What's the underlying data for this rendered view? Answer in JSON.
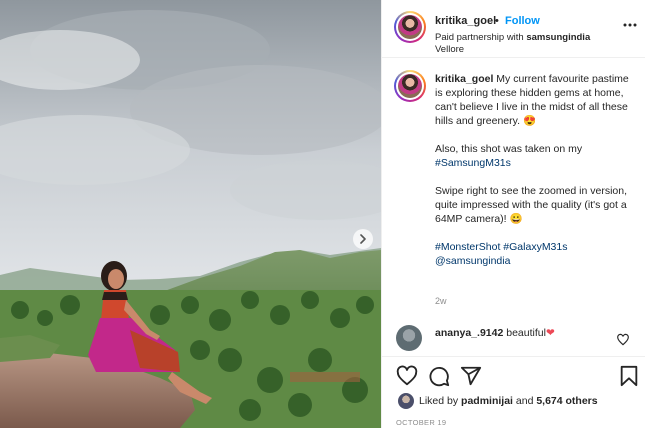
{
  "post": {
    "username": "kritika_goel",
    "follow_label": "Follow",
    "dot": "•",
    "paid_prefix": "Paid partnership with ",
    "partner": "samsungindia",
    "location": "Vellore"
  },
  "caption": {
    "username": "kritika_goel",
    "para1": " My current favourite pastime is exploring these hidden gems at home, can't believe I live in the midst of all these hills and greenery. 😍",
    "para2_text": "Also, this shot was taken on my ",
    "para2_tag": "#SamsungM31s",
    "para3": "Swipe right to see the zoomed in version, quite impressed with the quality (it's got a 64MP camera)! 😀",
    "tag1": "#MonsterShot",
    "tag2": "#GalaxyM31s",
    "mention": "@samsungindia",
    "age": "2w"
  },
  "comment": {
    "username": "ananya_.9142",
    "text": " beautiful",
    "emoji": "❤"
  },
  "likes": {
    "prefix": "Liked by ",
    "user": "padminijai",
    "middle": " and ",
    "count": "5,674 others"
  },
  "date": "OCTOBER 19",
  "icons": {
    "more": "more-options-icon",
    "like": "heart-icon",
    "comment": "comment-icon",
    "share": "share-icon",
    "save": "bookmark-icon",
    "next": "chevron-right-icon"
  },
  "colors": {
    "accent": "#0095f6",
    "hashtag": "#00376b",
    "secondary": "#8e8e8e",
    "text": "#262626"
  }
}
